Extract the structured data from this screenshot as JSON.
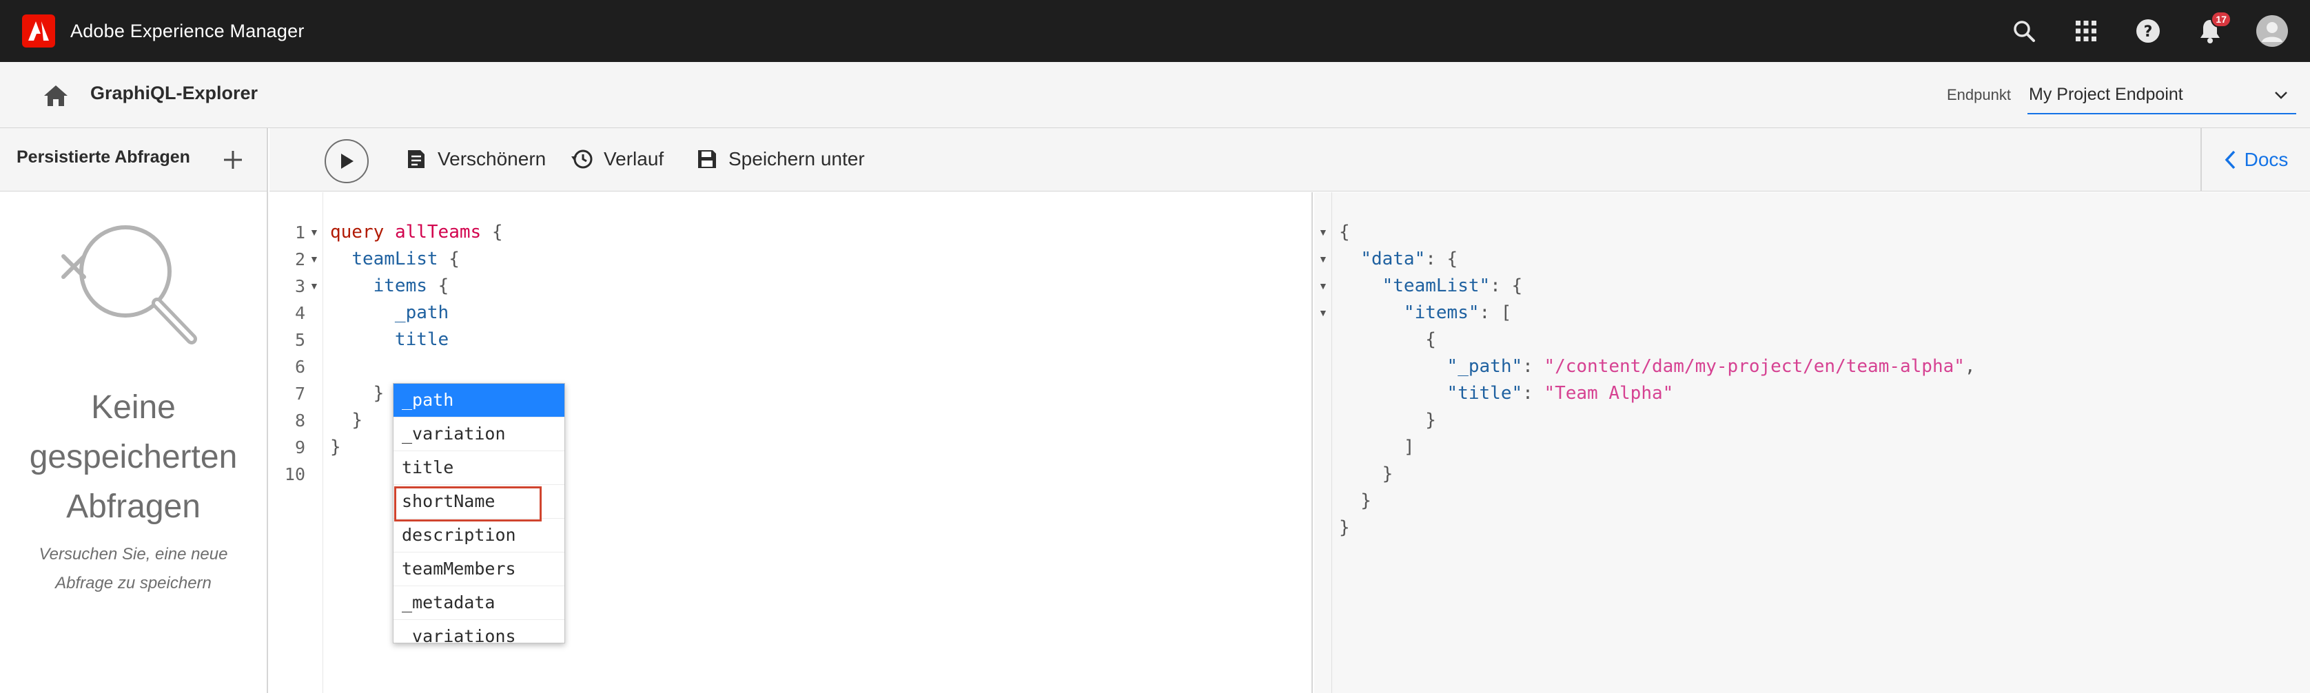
{
  "app": {
    "brand_name": "Adobe Experience Manager",
    "notification_count": "17",
    "colors": {
      "topbar": "#1e1e1e",
      "adobe_red": "#eb1000",
      "accent_blue": "#1473e6",
      "autocomplete_active": "#1e83ff",
      "highlight_box": "#d0442e"
    }
  },
  "header": {
    "title": "GraphiQL-Explorer",
    "endpoint_label": "Endpunkt",
    "endpoint_value": "My Project Endpoint"
  },
  "sidebar": {
    "title": "Persistierte Abfragen",
    "empty_title": "Keine gespeicherten Abfragen",
    "empty_title_lines": [
      "Keine",
      "gespeicherten",
      "Abfragen"
    ],
    "empty_subtitle_lines": [
      "Versuchen Sie, eine neue",
      "Abfrage zu speichern"
    ]
  },
  "toolbar": {
    "prettify_label": "Verschönern",
    "history_label": "Verlauf",
    "save_as_label": "Speichern unter",
    "docs_label": "Docs"
  },
  "editor": {
    "line_numbers": [
      "1",
      "2",
      "3",
      "4",
      "5",
      "6",
      "7",
      "8",
      "9",
      "10"
    ],
    "lines": [
      {
        "kw": "query",
        "name": "allTeams",
        "brace": "{"
      },
      {
        "field": "teamList",
        "brace": "{"
      },
      {
        "field": "items",
        "brace": "{"
      },
      {
        "field": "_path"
      },
      {
        "field": "title"
      },
      {},
      {
        "brace": "}"
      },
      {
        "brace": "}"
      },
      {
        "brace": "}"
      },
      {}
    ],
    "autocomplete": [
      "_path",
      "_variation",
      "title",
      "shortName",
      "description",
      "teamMembers",
      "_metadata",
      "_variations"
    ],
    "autocomplete_active": "_path",
    "autocomplete_highlighted": "shortName"
  },
  "result": {
    "open_brace": "{",
    "data_key": "\"data\"",
    "teamlist_key": "\"teamList\"",
    "items_key": "\"items\"",
    "path_key": "\"_path\"",
    "path_value": "\"/content/dam/my-project/en/team-alpha\"",
    "title_key": "\"title\"",
    "title_value": "\"Team Alpha\""
  }
}
